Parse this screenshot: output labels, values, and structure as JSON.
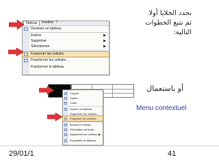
{
  "instruction": {
    "line1": "نحدد الخلايا أولا",
    "line2": "ثم نتبع الخطوات",
    "line3": "التالية:"
  },
  "alt_instruction": "أو باستعمال",
  "context_menu_caption": "Menu contextuel",
  "table_menu": {
    "menu_bar": [
      "Tableau",
      "Fenêtre",
      "?"
    ],
    "items": [
      {
        "label": "Dessiner un tableau",
        "has_submenu": false
      },
      {
        "label": "Insérer",
        "has_submenu": true
      },
      {
        "label": "Supprimer",
        "has_submenu": true
      },
      {
        "label": "Sélectionner",
        "has_submenu": true
      },
      {
        "label": "Fusionner les cellules",
        "has_submenu": false,
        "highlighted": true
      },
      {
        "label": "Fractionner les cellules...",
        "has_submenu": false
      },
      {
        "label": "Fractionner le tableau",
        "has_submenu": false
      }
    ]
  },
  "context_menu": {
    "items": [
      {
        "label": "Couper",
        "has_submenu": false
      },
      {
        "label": "Copier",
        "has_submenu": false
      },
      {
        "label": "Coller",
        "has_submenu": false
      },
      {
        "label": "Insérer un tableau...",
        "has_submenu": false
      },
      {
        "label": "Supprimer les cellules...",
        "has_submenu": false
      },
      {
        "label": "Fusionner les cellules",
        "has_submenu": false,
        "highlighted": true
      },
      {
        "label": "Bordure et trame...",
        "has_submenu": false
      },
      {
        "label": "Orientation du texte...",
        "has_submenu": false
      },
      {
        "label": "Alignement de cellules",
        "has_submenu": true
      },
      {
        "label": "Propriétés du tableau...",
        "has_submenu": false
      }
    ]
  },
  "footer": {
    "date": "29/01/1",
    "page_number": "41"
  },
  "colors": {
    "arrow_red": "#e2343a",
    "highlight": "#f6e3b7",
    "caption_blue": "#2a3a8a"
  }
}
